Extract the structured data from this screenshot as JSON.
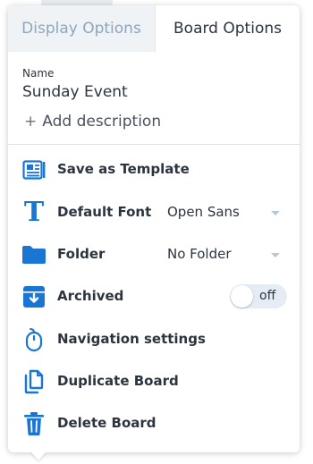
{
  "tabs": [
    {
      "label": "Display Options",
      "active": false
    },
    {
      "label": "Board Options",
      "active": true
    }
  ],
  "board": {
    "name_label": "Name",
    "name_value": "Sunday Event",
    "add_description": "Add description"
  },
  "menu": {
    "save_template": {
      "label": "Save as Template",
      "icon": "template-icon"
    },
    "default_font": {
      "label": "Default Font",
      "value": "Open Sans",
      "icon": "font-icon"
    },
    "folder": {
      "label": "Folder",
      "value": "No Folder",
      "icon": "folder-icon"
    },
    "archived": {
      "label": "Archived",
      "toggle_text": "off",
      "checked": false,
      "icon": "archive-icon"
    },
    "navigation": {
      "label": "Navigation settings",
      "icon": "mouse-icon"
    },
    "duplicate": {
      "label": "Duplicate Board",
      "icon": "duplicate-icon"
    },
    "delete": {
      "label": "Delete Board",
      "icon": "trash-icon"
    }
  },
  "colors": {
    "accent": "#1976d2",
    "text": "#2c3440",
    "inactive_tab_text": "#8ea6bb",
    "inactive_tab_bg": "#f0f3f6"
  }
}
